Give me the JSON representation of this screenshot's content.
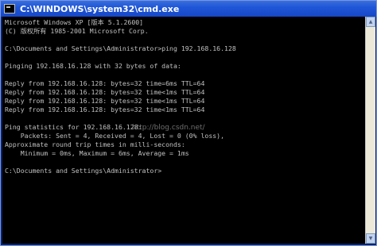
{
  "window": {
    "title": "C:\\WINDOWS\\system32\\cmd.exe"
  },
  "console": {
    "lines": [
      "Microsoft Windows XP [版本 5.1.2600]",
      "(C) 版权所有 1985-2001 Microsoft Corp.",
      "",
      "C:\\Documents and Settings\\Administrator>ping 192.168.16.128",
      "",
      "Pinging 192.168.16.128 with 32 bytes of data:",
      "",
      "Reply from 192.168.16.128: bytes=32 time=6ms TTL=64",
      "Reply from 192.168.16.128: bytes=32 time<1ms TTL=64",
      "Reply from 192.168.16.128: bytes=32 time<1ms TTL=64",
      "Reply from 192.168.16.128: bytes=32 time<1ms TTL=64",
      "",
      "Ping statistics for 192.168.16.128:",
      "    Packets: Sent = 4, Received = 4, Lost = 0 (0% loss),",
      "Approximate round trip times in milli-seconds:",
      "    Minimum = 0ms, Maximum = 6ms, Average = 1ms",
      "",
      "C:\\Documents and Settings\\Administrator>"
    ]
  },
  "watermark": "http://blog.csdn.net/",
  "colors": {
    "console_bg": "#000000",
    "console_text": "#c0c0c0",
    "titlebar": "#1f56d8"
  },
  "icons": {
    "app": "cmd-icon",
    "scroll_up": "arrow-up-icon",
    "scroll_down": "arrow-down-icon"
  }
}
